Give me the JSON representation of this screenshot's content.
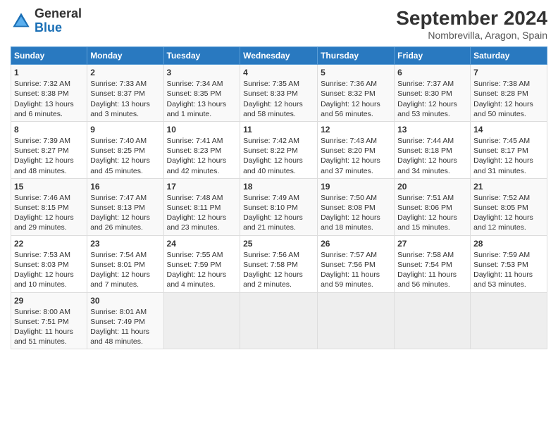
{
  "header": {
    "logo_general": "General",
    "logo_blue": "Blue",
    "month_title": "September 2024",
    "subtitle": "Nombrevilla, Aragon, Spain"
  },
  "calendar": {
    "columns": [
      "Sunday",
      "Monday",
      "Tuesday",
      "Wednesday",
      "Thursday",
      "Friday",
      "Saturday"
    ],
    "rows": [
      [
        {
          "day": "1",
          "lines": [
            "Sunrise: 7:32 AM",
            "Sunset: 8:38 PM",
            "Daylight: 13 hours",
            "and 6 minutes."
          ]
        },
        {
          "day": "2",
          "lines": [
            "Sunrise: 7:33 AM",
            "Sunset: 8:37 PM",
            "Daylight: 13 hours",
            "and 3 minutes."
          ]
        },
        {
          "day": "3",
          "lines": [
            "Sunrise: 7:34 AM",
            "Sunset: 8:35 PM",
            "Daylight: 13 hours",
            "and 1 minute."
          ]
        },
        {
          "day": "4",
          "lines": [
            "Sunrise: 7:35 AM",
            "Sunset: 8:33 PM",
            "Daylight: 12 hours",
            "and 58 minutes."
          ]
        },
        {
          "day": "5",
          "lines": [
            "Sunrise: 7:36 AM",
            "Sunset: 8:32 PM",
            "Daylight: 12 hours",
            "and 56 minutes."
          ]
        },
        {
          "day": "6",
          "lines": [
            "Sunrise: 7:37 AM",
            "Sunset: 8:30 PM",
            "Daylight: 12 hours",
            "and 53 minutes."
          ]
        },
        {
          "day": "7",
          "lines": [
            "Sunrise: 7:38 AM",
            "Sunset: 8:28 PM",
            "Daylight: 12 hours",
            "and 50 minutes."
          ]
        }
      ],
      [
        {
          "day": "8",
          "lines": [
            "Sunrise: 7:39 AM",
            "Sunset: 8:27 PM",
            "Daylight: 12 hours",
            "and 48 minutes."
          ]
        },
        {
          "day": "9",
          "lines": [
            "Sunrise: 7:40 AM",
            "Sunset: 8:25 PM",
            "Daylight: 12 hours",
            "and 45 minutes."
          ]
        },
        {
          "day": "10",
          "lines": [
            "Sunrise: 7:41 AM",
            "Sunset: 8:23 PM",
            "Daylight: 12 hours",
            "and 42 minutes."
          ]
        },
        {
          "day": "11",
          "lines": [
            "Sunrise: 7:42 AM",
            "Sunset: 8:22 PM",
            "Daylight: 12 hours",
            "and 40 minutes."
          ]
        },
        {
          "day": "12",
          "lines": [
            "Sunrise: 7:43 AM",
            "Sunset: 8:20 PM",
            "Daylight: 12 hours",
            "and 37 minutes."
          ]
        },
        {
          "day": "13",
          "lines": [
            "Sunrise: 7:44 AM",
            "Sunset: 8:18 PM",
            "Daylight: 12 hours",
            "and 34 minutes."
          ]
        },
        {
          "day": "14",
          "lines": [
            "Sunrise: 7:45 AM",
            "Sunset: 8:17 PM",
            "Daylight: 12 hours",
            "and 31 minutes."
          ]
        }
      ],
      [
        {
          "day": "15",
          "lines": [
            "Sunrise: 7:46 AM",
            "Sunset: 8:15 PM",
            "Daylight: 12 hours",
            "and 29 minutes."
          ]
        },
        {
          "day": "16",
          "lines": [
            "Sunrise: 7:47 AM",
            "Sunset: 8:13 PM",
            "Daylight: 12 hours",
            "and 26 minutes."
          ]
        },
        {
          "day": "17",
          "lines": [
            "Sunrise: 7:48 AM",
            "Sunset: 8:11 PM",
            "Daylight: 12 hours",
            "and 23 minutes."
          ]
        },
        {
          "day": "18",
          "lines": [
            "Sunrise: 7:49 AM",
            "Sunset: 8:10 PM",
            "Daylight: 12 hours",
            "and 21 minutes."
          ]
        },
        {
          "day": "19",
          "lines": [
            "Sunrise: 7:50 AM",
            "Sunset: 8:08 PM",
            "Daylight: 12 hours",
            "and 18 minutes."
          ]
        },
        {
          "day": "20",
          "lines": [
            "Sunrise: 7:51 AM",
            "Sunset: 8:06 PM",
            "Daylight: 12 hours",
            "and 15 minutes."
          ]
        },
        {
          "day": "21",
          "lines": [
            "Sunrise: 7:52 AM",
            "Sunset: 8:05 PM",
            "Daylight: 12 hours",
            "and 12 minutes."
          ]
        }
      ],
      [
        {
          "day": "22",
          "lines": [
            "Sunrise: 7:53 AM",
            "Sunset: 8:03 PM",
            "Daylight: 12 hours",
            "and 10 minutes."
          ]
        },
        {
          "day": "23",
          "lines": [
            "Sunrise: 7:54 AM",
            "Sunset: 8:01 PM",
            "Daylight: 12 hours",
            "and 7 minutes."
          ]
        },
        {
          "day": "24",
          "lines": [
            "Sunrise: 7:55 AM",
            "Sunset: 7:59 PM",
            "Daylight: 12 hours",
            "and 4 minutes."
          ]
        },
        {
          "day": "25",
          "lines": [
            "Sunrise: 7:56 AM",
            "Sunset: 7:58 PM",
            "Daylight: 12 hours",
            "and 2 minutes."
          ]
        },
        {
          "day": "26",
          "lines": [
            "Sunrise: 7:57 AM",
            "Sunset: 7:56 PM",
            "Daylight: 11 hours",
            "and 59 minutes."
          ]
        },
        {
          "day": "27",
          "lines": [
            "Sunrise: 7:58 AM",
            "Sunset: 7:54 PM",
            "Daylight: 11 hours",
            "and 56 minutes."
          ]
        },
        {
          "day": "28",
          "lines": [
            "Sunrise: 7:59 AM",
            "Sunset: 7:53 PM",
            "Daylight: 11 hours",
            "and 53 minutes."
          ]
        }
      ],
      [
        {
          "day": "29",
          "lines": [
            "Sunrise: 8:00 AM",
            "Sunset: 7:51 PM",
            "Daylight: 11 hours",
            "and 51 minutes."
          ]
        },
        {
          "day": "30",
          "lines": [
            "Sunrise: 8:01 AM",
            "Sunset: 7:49 PM",
            "Daylight: 11 hours",
            "and 48 minutes."
          ]
        },
        {
          "day": "",
          "lines": []
        },
        {
          "day": "",
          "lines": []
        },
        {
          "day": "",
          "lines": []
        },
        {
          "day": "",
          "lines": []
        },
        {
          "day": "",
          "lines": []
        }
      ]
    ]
  }
}
